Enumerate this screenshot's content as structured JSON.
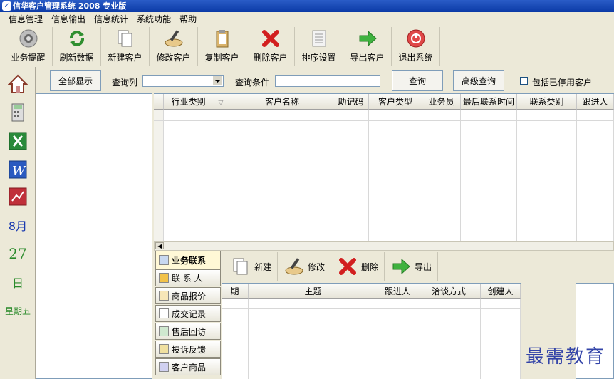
{
  "window": {
    "title": "信华客户管理系统 2008 专业版"
  },
  "menu": [
    "信息管理",
    "信息输出",
    "信息统计",
    "系统功能",
    "帮助"
  ],
  "toolbar": [
    {
      "label": "业务提醒",
      "icon": "speaker-icon"
    },
    {
      "label": "刷新数据",
      "icon": "refresh-icon"
    },
    {
      "label": "新建客户",
      "icon": "new-document-icon"
    },
    {
      "label": "修改客户",
      "icon": "edit-icon"
    },
    {
      "label": "复制客户",
      "icon": "clipboard-icon"
    },
    {
      "label": "删除客户",
      "icon": "delete-icon"
    },
    {
      "label": "排序设置",
      "icon": "sort-icon"
    },
    {
      "label": "导出客户",
      "icon": "export-arrow-icon"
    },
    {
      "label": "退出系统",
      "icon": "power-icon"
    }
  ],
  "sidebar": {
    "icons": [
      "home-icon",
      "calculator-icon",
      "excel-icon",
      "word-icon",
      "chart-icon"
    ],
    "month": "8月",
    "day": "27",
    "day_label": "日",
    "weekday": "星期五"
  },
  "query": {
    "show_all": "全部显示",
    "column_label": "查询列",
    "condition_label": "查询条件",
    "search_button": "查询",
    "advanced_button": "高级查询",
    "include_disabled": "包括已停用客户"
  },
  "grid": {
    "columns": [
      "行业类别",
      "客户名称",
      "助记码",
      "客户类型",
      "业务员",
      "最后联系时间",
      "联系类别",
      "跟进人"
    ]
  },
  "tabs": [
    "业务联系",
    "联 系 人",
    "商品报价",
    "成交记录",
    "售后回访",
    "投诉反馈",
    "客户商品"
  ],
  "subtoolbar": [
    {
      "label": "新建",
      "icon": "new-document-icon"
    },
    {
      "label": "修改",
      "icon": "edit-icon"
    },
    {
      "label": "删除",
      "icon": "delete-icon"
    },
    {
      "label": "导出",
      "icon": "export-arrow-icon"
    }
  ],
  "subgrid": {
    "columns": [
      "期",
      "主题",
      "跟进人",
      "洽谈方式",
      "创建人"
    ]
  },
  "watermark": "最需教育"
}
